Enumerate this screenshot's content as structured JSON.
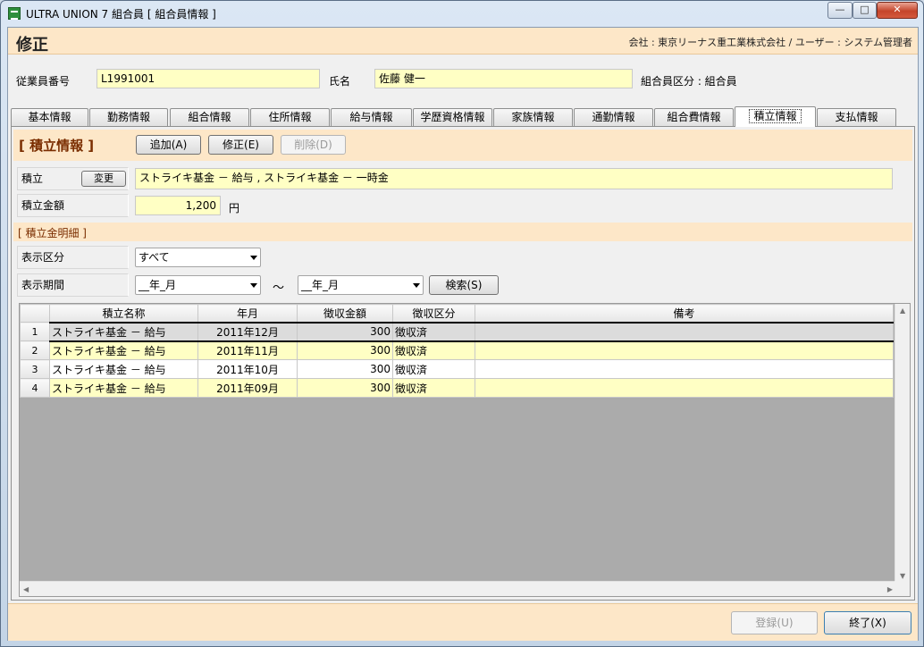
{
  "window": {
    "title": "ULTRA UNION 7 組合員 [ 組合員情報 ]"
  },
  "header": {
    "mode_title": "修正",
    "company_info": "会社 : 東京リーナス重工業株式会社 / ユーザー : システム管理者"
  },
  "employee": {
    "id_label": "従業員番号",
    "id_value": "L1991001",
    "name_label": "氏名",
    "name_value": "佐藤 健一",
    "category": "組合員区分 : 組合員"
  },
  "tabs": [
    "基本情報",
    "勤務情報",
    "組合情報",
    "住所情報",
    "給与情報",
    "学歴資格情報",
    "家族情報",
    "通勤情報",
    "組合費情報",
    "積立情報",
    "支払情報"
  ],
  "active_tab": "積立情報",
  "section": {
    "title": "[ 積立情報 ]",
    "add_button": "追加(A)",
    "edit_button": "修正(E)",
    "delete_button": "削除(D)"
  },
  "savings": {
    "label": "積立",
    "change_button": "変更",
    "value": "ストライキ基金 － 給与 , ストライキ基金 － 一時金",
    "amount_label": "積立金額",
    "amount_value": "1,200",
    "amount_unit": "円"
  },
  "detail": {
    "title": "[ 積立金明細 ]",
    "display_category_label": "表示区分",
    "display_category_value": "すべて",
    "period_label": "表示期間",
    "period_from": "__年_月",
    "tilde": "～",
    "period_to": "__年_月",
    "search_button": "検索(S)"
  },
  "table": {
    "columns": [
      "",
      "積立名称",
      "年月",
      "徴収金額",
      "徴収区分",
      "備考"
    ],
    "rows": [
      {
        "no": "1",
        "name": "ストライキ基金 － 給与",
        "month": "2011年12月",
        "amount": "300",
        "status": "徴収済",
        "note": ""
      },
      {
        "no": "2",
        "name": "ストライキ基金 － 給与",
        "month": "2011年11月",
        "amount": "300",
        "status": "徴収済",
        "note": ""
      },
      {
        "no": "3",
        "name": "ストライキ基金 － 給与",
        "month": "2011年10月",
        "amount": "300",
        "status": "徴収済",
        "note": ""
      },
      {
        "no": "4",
        "name": "ストライキ基金 － 給与",
        "month": "2011年09月",
        "amount": "300",
        "status": "徴収済",
        "note": ""
      }
    ]
  },
  "footer": {
    "register_button": "登録(U)",
    "close_button": "終了(X)"
  }
}
